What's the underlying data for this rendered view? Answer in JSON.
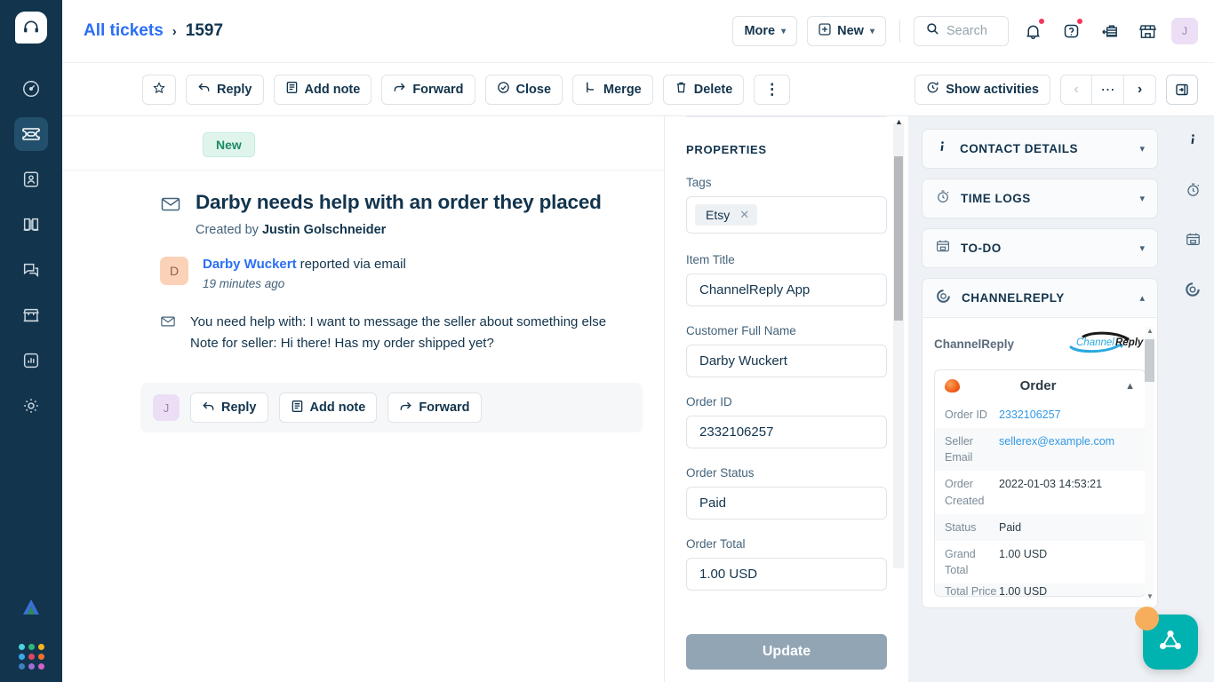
{
  "left_rail": {
    "logo_icon": "headset-logo-icon",
    "items": [
      {
        "name": "dashboard",
        "icon": "gauge-icon",
        "active": false
      },
      {
        "name": "tickets",
        "icon": "ticket-icon",
        "active": true
      },
      {
        "name": "contacts",
        "icon": "contact-card-icon",
        "active": false
      },
      {
        "name": "knowledge-base",
        "icon": "book-icon",
        "active": false
      },
      {
        "name": "chat",
        "icon": "chat-bubbles-icon",
        "active": false
      },
      {
        "name": "storefront",
        "icon": "storefront-icon",
        "active": false
      },
      {
        "name": "reports",
        "icon": "bar-chart-icon",
        "active": false
      },
      {
        "name": "settings",
        "icon": "gear-icon",
        "active": false
      }
    ],
    "bottom": {
      "brand_icon": "freshworks-arrow-icon",
      "switcher_icon": "app-switcher-grid-icon",
      "switcher_colors": [
        "#4fd2e0",
        "#2fb87a",
        "#f5b41d",
        "#3da7e8",
        "#e0465f",
        "#f0702a",
        "#3d7fc1",
        "#9b6fd4",
        "#d163c9"
      ]
    }
  },
  "header": {
    "breadcrumb": {
      "root": "All tickets",
      "separator": "›",
      "current": "1597"
    },
    "more_label": "More",
    "new_label": "New",
    "search_placeholder": "Search",
    "icons": {
      "search": "search-icon",
      "notifications": "bell-icon",
      "help": "question-mark-icon",
      "news": "announcement-icon",
      "marketplace": "storefront-icon"
    },
    "avatar_initial": "J"
  },
  "toolbar": {
    "star_label": "",
    "reply_label": "Reply",
    "add_note_label": "Add note",
    "forward_label": "Forward",
    "close_label": "Close",
    "merge_label": "Merge",
    "delete_label": "Delete",
    "more_menu_label": "⋮",
    "show_activities_label": "Show activities",
    "pager": {
      "prev": "‹",
      "mid": "⋯",
      "next": "›"
    },
    "panel_toggle_icon": "panel-collapse-icon"
  },
  "ticket": {
    "status_badge": "New",
    "subject": "Darby needs help with an order they placed",
    "created_by_label": "Created by",
    "created_by_name": "Justin Golschneider",
    "reporter": {
      "initial": "D",
      "name": "Darby Wuckert",
      "action": "reported via email",
      "time": "19 minutes ago"
    },
    "message_lines": [
      "You need help with: I want to message the seller about something else",
      "Note for seller: Hi there! Has my order shipped yet?"
    ],
    "reply_bar": {
      "avatar_initial": "J",
      "reply_label": "Reply",
      "add_note_label": "Add note",
      "forward_label": "Forward"
    }
  },
  "properties": {
    "title": "PROPERTIES",
    "fields": [
      {
        "label": "Tags",
        "type": "tags",
        "tags": [
          {
            "text": "Etsy"
          }
        ]
      },
      {
        "label": "Item Title",
        "type": "text",
        "value": "ChannelReply App"
      },
      {
        "label": "Customer Full Name",
        "type": "text",
        "value": "Darby Wuckert"
      },
      {
        "label": "Order ID",
        "type": "text",
        "value": "2332106257"
      },
      {
        "label": "Order Status",
        "type": "text",
        "value": "Paid"
      },
      {
        "label": "Order Total",
        "type": "text",
        "value": "1.00 USD"
      }
    ],
    "update_label": "Update"
  },
  "rightbar": {
    "panels": [
      {
        "title": "CONTACT DETAILS",
        "icon": "info-icon",
        "expanded": false
      },
      {
        "title": "TIME LOGS",
        "icon": "stopwatch-icon",
        "expanded": false
      },
      {
        "title": "TO-DO",
        "icon": "calendar-icon",
        "expanded": false
      },
      {
        "title": "CHANNELREPLY",
        "icon": "channelreply-icon",
        "expanded": true
      }
    ],
    "channelreply": {
      "app_name": "ChannelReply",
      "logo_text_a": "Channel",
      "logo_text_b": "Reply",
      "card": {
        "marketplace_icon": "etsy-icon",
        "title": "Order",
        "collapse_icon": "chevron-up-icon",
        "rows": [
          {
            "key": "Order ID",
            "value": "2332106257",
            "link": true
          },
          {
            "key": "Seller Email",
            "value": "sellerex@example.com",
            "link": true
          },
          {
            "key": "Order Created",
            "value": "2022-01-03 14:53:21",
            "link": false
          },
          {
            "key": "Status",
            "value": "Paid",
            "link": false
          },
          {
            "key": "Grand Total",
            "value": "1.00 USD",
            "link": false
          },
          {
            "key": "Total Price",
            "value": "1.00 USD",
            "link": false
          }
        ]
      }
    }
  },
  "icon_rail": {
    "items": [
      {
        "name": "contact-details",
        "icon": "info-icon"
      },
      {
        "name": "time-logs",
        "icon": "stopwatch-icon"
      },
      {
        "name": "to-do",
        "icon": "calendar-icon"
      },
      {
        "name": "channelreply",
        "icon": "channelreply-icon"
      }
    ]
  },
  "fab": {
    "icon": "network-triangle-icon",
    "color": "#00b3b0",
    "badge_color": "#f6ae5c"
  }
}
